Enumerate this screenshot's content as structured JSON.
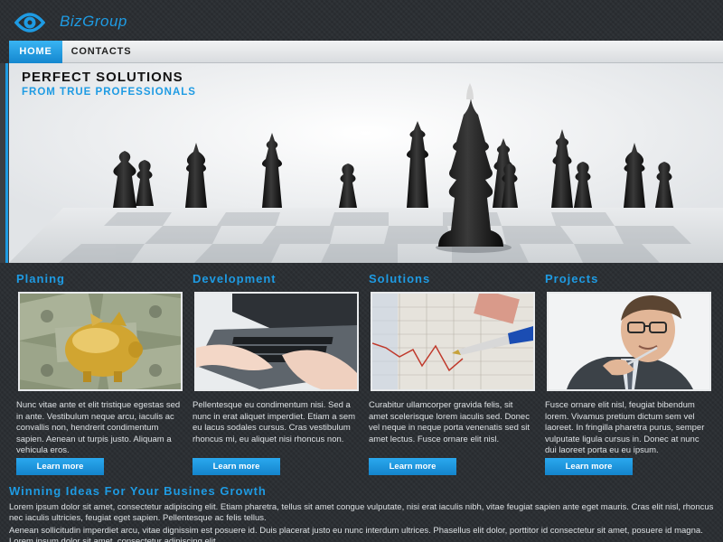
{
  "brand": {
    "name": "BizGroup",
    "logo_icon": "eye-logo-icon",
    "color": "#1e9be3"
  },
  "nav": {
    "items": [
      {
        "label": "HOME",
        "active": true
      },
      {
        "label": "CONTACTS",
        "active": false
      }
    ]
  },
  "hero": {
    "title": "PERFECT SOLUTIONS",
    "subtitle": "FROM TRUE PROFESSIONALS",
    "image": "chess-pieces-photo"
  },
  "columns": [
    {
      "title": "Planing",
      "image": "golden-piggy-bank-on-money-photo",
      "text": "Nunc vitae ante et elit tristique egestas sed in ante. Vestibulum neque arcu, iaculis ac convallis non, hendrerit condimentum sapien. Aenean ut turpis justo. Aliquam a vehicula eros.",
      "button": "Learn more"
    },
    {
      "title": "Development",
      "image": "hands-typing-laptop-photo",
      "text": "Pellentesque eu condimentum nisi. Sed a nunc in erat aliquet imperdiet. Etiam a sem eu lacus sodales cursus. Cras vestibulum rhoncus mi, eu aliquet nisi rhoncus non.",
      "button": "Learn more"
    },
    {
      "title": "Solutions",
      "image": "pen-on-financial-chart-photo",
      "text": "Curabitur ullamcorper gravida felis, sit amet scelerisque lorem iaculis sed. Donec vel neque in neque porta venenatis sed sit amet lectus. Fusce ornare elit nisl.",
      "button": "Learn more"
    },
    {
      "title": "Projects",
      "image": "businessman-with-glasses-photo",
      "text": "Fusce ornare elit nisl, feugiat bibendum lorem. Vivamus pretium dictum sem vel laoreet. In fringilla pharetra purus, semper vulputate ligula cursus in. Donec at nunc dui laoreet porta eu eu ipsum.",
      "button": "Learn more"
    }
  ],
  "section": {
    "title": "Winning Ideas For Your Busines Growth",
    "paragraphs": [
      "Lorem ipsum dolor sit amet, consectetur adipiscing elit. Etiam pharetra, tellus sit amet congue vulputate, nisi erat iaculis nibh, vitae feugiat sapien ante eget mauris. Cras elit nisl, rhoncus nec iaculis ultricies, feugiat eget sapien. Pellentesque ac felis tellus.",
      "Aenean sollicitudin imperdiet arcu, vitae dignissim est posuere id. Duis placerat justo eu nunc interdum ultrices. Phasellus elit dolor, porttitor id consectetur sit amet, posuere id magna. Lorem ipsum dolor sit amet, consectetur adipiscing elit."
    ]
  },
  "colors": {
    "accent": "#1e9be3",
    "background": "#2b2f33",
    "nav_active": "#1e9be3"
  }
}
